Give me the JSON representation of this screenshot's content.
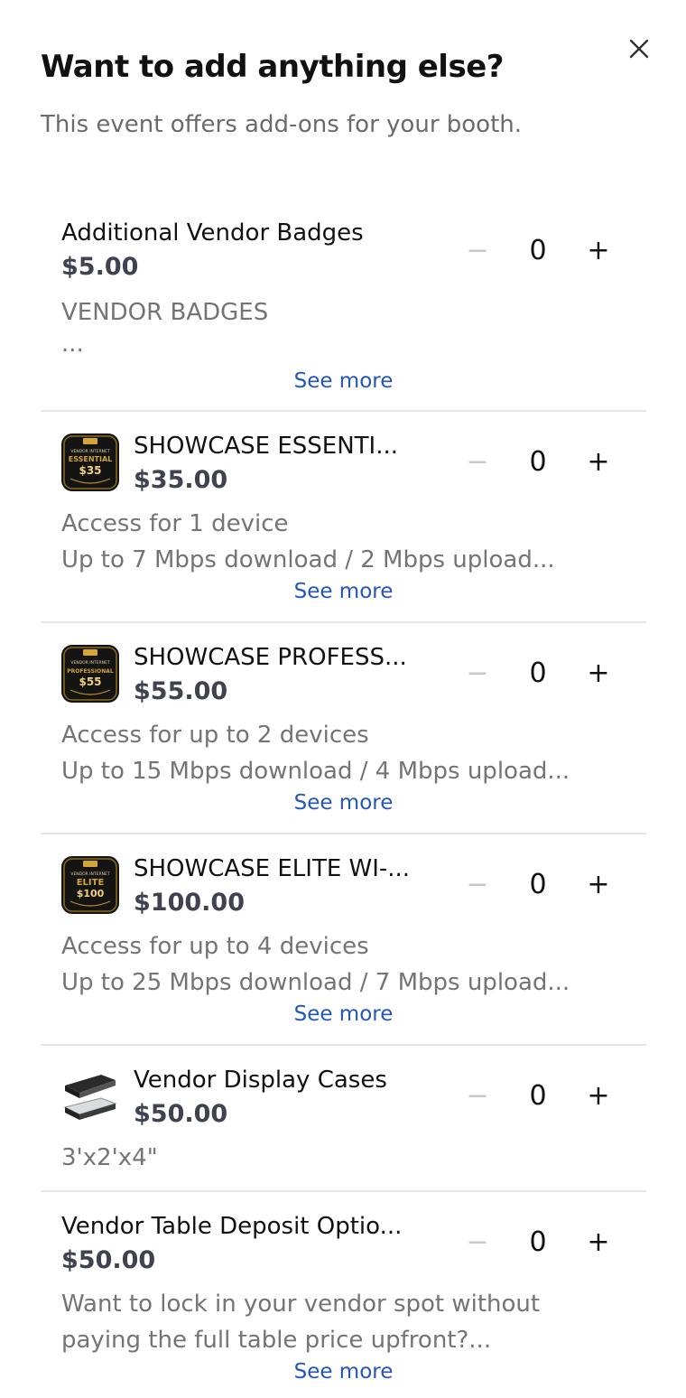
{
  "modal": {
    "title": "Want to add anything else?",
    "subtitle": "This event offers add-ons for your booth.",
    "close_icon": "close-icon"
  },
  "addons": [
    {
      "name": "Additional Vendor Badges",
      "price": "$5.00",
      "desc_line1": "VENDOR BADGES",
      "desc_line2": "...",
      "see_more": "See more",
      "quantity": "0",
      "minus": "−",
      "plus": "+"
    },
    {
      "name": "SHOWCASE ESSENTI...",
      "price": "$35.00",
      "desc_line1": "Access for 1 device",
      "desc_line2": "Up to 7 Mbps download / 2 Mbps upload...",
      "see_more": "See more",
      "quantity": "0",
      "minus": "−",
      "plus": "+",
      "thumb": {
        "tier": "ESSENTIAL",
        "price": "$35",
        "header": "VENDOR INTERNET"
      }
    },
    {
      "name": "SHOWCASE PROFESS...",
      "price": "$55.00",
      "desc_line1": "Access for up to 2 devices",
      "desc_line2": "Up to 15 Mbps download / 4 Mbps upload...",
      "see_more": "See more",
      "quantity": "0",
      "minus": "−",
      "plus": "+",
      "thumb": {
        "tier": "PROFESSIONAL",
        "price": "$55",
        "header": "VENDOR INTERNET"
      }
    },
    {
      "name": "SHOWCASE ELITE WI-...",
      "price": "$100.00",
      "desc_line1": "Access for up to 4 devices",
      "desc_line2": "Up to 25 Mbps download / 7 Mbps upload...",
      "see_more": "See more",
      "quantity": "0",
      "minus": "−",
      "plus": "+",
      "thumb": {
        "tier": "ELITE",
        "price": "$100",
        "header": "VENDOR INTERNET"
      }
    },
    {
      "name": "Vendor Display Cases",
      "price": "$50.00",
      "desc_line1": "3'x2'x4\"",
      "quantity": "0",
      "minus": "−",
      "plus": "+"
    },
    {
      "name": "Vendor Table Deposit Optio...",
      "price": "$50.00",
      "desc_line1": "Want to lock in your vendor spot without",
      "desc_line2": "paying the full table price upfront?...",
      "see_more": "See more",
      "quantity": "0",
      "minus": "−",
      "plus": "+"
    }
  ],
  "colors": {
    "accent_link": "#2456b8",
    "price": "#3f4350",
    "muted_text": "#747474",
    "divider": "#e5e5e5",
    "thumb_gold": "#d4a437"
  }
}
